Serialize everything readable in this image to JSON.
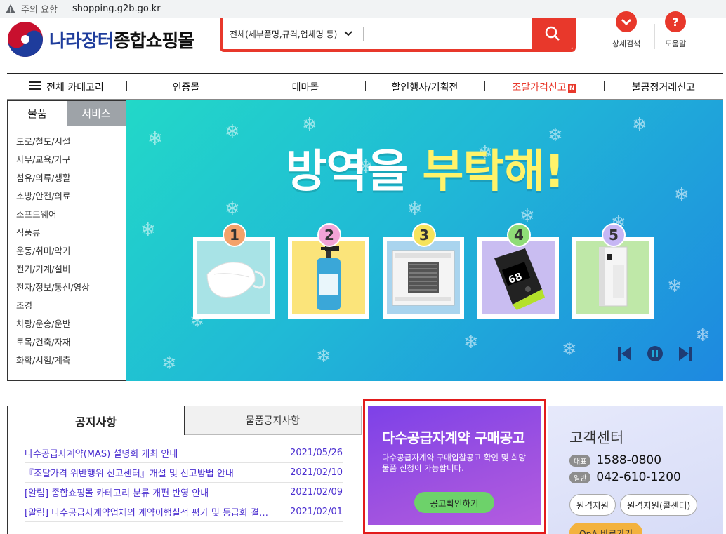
{
  "browser": {
    "warning_label": "주의 요함",
    "url": "shopping.g2b.go.kr"
  },
  "header": {
    "logo_part1": "나라장터",
    "logo_part2": "종합쇼핑몰",
    "search_category": "전체(세부품명,규격,업체명 등)",
    "search_value": "",
    "detail_search": "상세검색",
    "help": "도움말"
  },
  "nav": {
    "items": [
      {
        "label": "전체 카테고리"
      },
      {
        "label": "인증몰"
      },
      {
        "label": "테마몰"
      },
      {
        "label": "할인행사/기획전"
      },
      {
        "label": "조달가격신고",
        "badge": "N"
      },
      {
        "label": "불공정거래신고"
      }
    ]
  },
  "sidebar": {
    "tabs": [
      "물품",
      "서비스"
    ],
    "categories": [
      "도로/철도/시설",
      "사무/교육/가구",
      "섬유/의류/생활",
      "소방/안전/의료",
      "소프트웨어",
      "식품류",
      "운동/취미/악기",
      "전기/기계/설비",
      "전자/정보/통신/영상",
      "조경",
      "차량/운송/운반",
      "토목/건축/자재",
      "화학/시험/계측"
    ]
  },
  "banner": {
    "headline_plain": "방역을 ",
    "headline_highlight": "부탁해!",
    "products": [
      {
        "num": "1",
        "num_color": "#f4a26a",
        "bg": "#a8e3e6",
        "icon": "mask-icon"
      },
      {
        "num": "2",
        "num_color": "#f2a3d6",
        "bg": "#fbe47a",
        "icon": "sanitizer-icon"
      },
      {
        "num": "3",
        "num_color": "#f6e35c",
        "bg": "#a9d4ee",
        "icon": "air-conditioner-icon"
      },
      {
        "num": "4",
        "num_color": "#8fdc77",
        "bg": "#c9bdf1",
        "icon": "oximeter-icon"
      },
      {
        "num": "5",
        "num_color": "#c6b6f4",
        "bg": "#bfe8a8",
        "icon": "air-purifier-icon"
      }
    ],
    "oximeter_reading": "68"
  },
  "notice": {
    "tab_active": "공지사항",
    "tab_inactive": "물품공지사항",
    "items": [
      {
        "title": "다수공급자계약(MAS) 설명회 개최 안내",
        "date": "2021/05/26"
      },
      {
        "title": "『조달가격 위반행위 신고센터』개설 및 신고방법 안내",
        "date": "2021/02/10"
      },
      {
        "title": "[알림] 종합쇼핑몰 카테고리 분류 개편 반영 안내",
        "date": "2021/02/09"
      },
      {
        "title": "[알림] 다수공급자계약업체의 계약이행실적 평가 및 등급화 결…",
        "date": "2021/02/01"
      }
    ]
  },
  "promo": {
    "title": "다수공급자계약 구매공고",
    "desc": "다수공급자계약 구매입찰공고 확인 및 희망 물품 신청이 가능합니다.",
    "button": "공고확인하기"
  },
  "customer": {
    "title": "고객센터",
    "rep_tag": "대표",
    "rep_phone": "1588-0800",
    "gen_tag": "일반",
    "gen_phone": "042-610-1200",
    "remote1": "원격지원",
    "remote2": "원격지원(콜센터)",
    "qna": "QnA 바로가기"
  },
  "colors": {
    "accent": "#e8382b",
    "notice_link": "#4b2fd0",
    "promo_bg": "#8a48e6",
    "highlight_frame": "#e21b1b"
  }
}
